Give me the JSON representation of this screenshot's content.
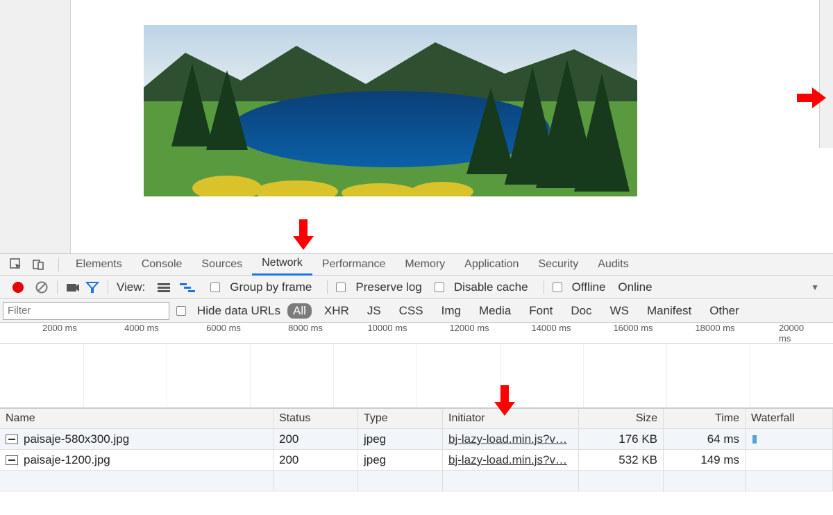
{
  "tabs": {
    "items": [
      "Elements",
      "Console",
      "Sources",
      "Network",
      "Performance",
      "Memory",
      "Application",
      "Security",
      "Audits"
    ],
    "active_index": 3
  },
  "toolbar": {
    "view_label": "View:",
    "group_by_frame": "Group by frame",
    "preserve_log": "Preserve log",
    "disable_cache": "Disable cache",
    "offline": "Offline",
    "online": "Online"
  },
  "filter": {
    "placeholder": "Filter",
    "hide_data_urls": "Hide data URLs",
    "categories": [
      "All",
      "XHR",
      "JS",
      "CSS",
      "Img",
      "Media",
      "Font",
      "Doc",
      "WS",
      "Manifest",
      "Other"
    ],
    "active_index": 0
  },
  "timeline": {
    "ticks": [
      "2000 ms",
      "4000 ms",
      "6000 ms",
      "8000 ms",
      "10000 ms",
      "12000 ms",
      "14000 ms",
      "16000 ms",
      "18000 ms",
      "20000 ms"
    ]
  },
  "table": {
    "headers": {
      "name": "Name",
      "status": "Status",
      "type": "Type",
      "initiator": "Initiator",
      "size": "Size",
      "time": "Time",
      "waterfall": "Waterfall"
    },
    "rows": [
      {
        "name": "paisaje-580x300.jpg",
        "status": "200",
        "type": "jpeg",
        "initiator": "bj-lazy-load.min.js?v…",
        "size": "176 KB",
        "time": "64 ms"
      },
      {
        "name": "paisaje-1200.jpg",
        "status": "200",
        "type": "jpeg",
        "initiator": "bj-lazy-load.min.js?v…",
        "size": "532 KB",
        "time": "149 ms"
      }
    ]
  },
  "icons": {
    "inspect": "inspect-icon",
    "device": "device-icon",
    "record": "record-icon",
    "clear": "clear-icon",
    "camera": "camera-icon",
    "filter": "filter-icon"
  }
}
